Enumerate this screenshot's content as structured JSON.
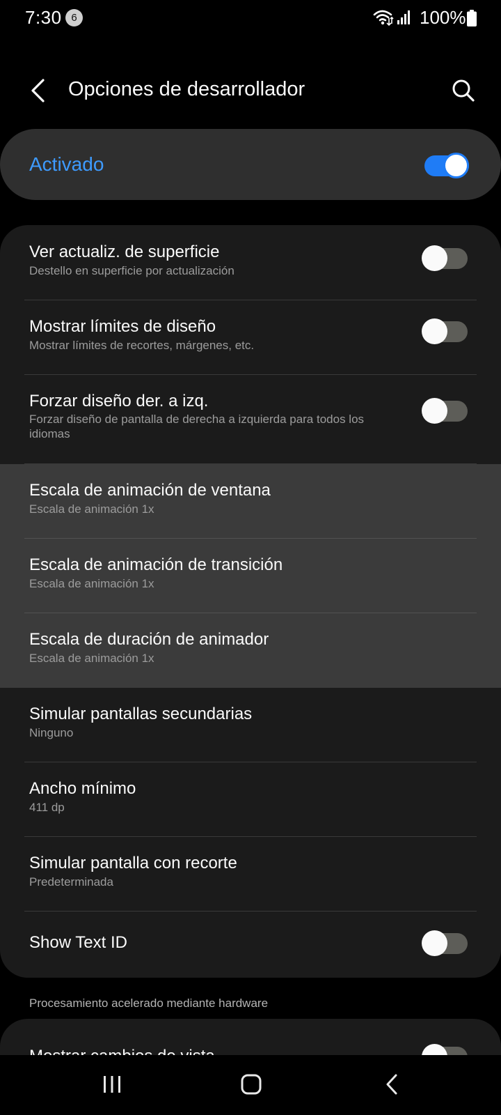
{
  "status_bar": {
    "time": "7:30",
    "notification_count": "6",
    "battery_percent": "100%",
    "icons": [
      "wifi-icon",
      "signal-icon",
      "battery-icon"
    ]
  },
  "header": {
    "title": "Opciones de desarrollador",
    "back_icon": "back-chevron-icon",
    "search_icon": "search-icon"
  },
  "master_switch": {
    "label": "Activado",
    "on": true
  },
  "rows": [
    {
      "title": "Ver actualiz. de superficie",
      "subtitle": "Destello en superficie por actualización",
      "toggle": false
    },
    {
      "title": "Mostrar límites de diseño",
      "subtitle": "Mostrar límites de recortes, márgenes, etc.",
      "toggle": false
    },
    {
      "title": "Forzar diseño der. a izq.",
      "subtitle": "Forzar diseño de pantalla de derecha a izquierda para todos los idiomas",
      "toggle": false
    },
    {
      "title": "Escala de animación de ventana",
      "subtitle": "Escala de animación 1x"
    },
    {
      "title": "Escala de animación de transición",
      "subtitle": "Escala de animación 1x"
    },
    {
      "title": "Escala de duración de animador",
      "subtitle": "Escala de animación 1x"
    },
    {
      "title": "Simular pantallas secundarias",
      "subtitle": "Ninguno"
    },
    {
      "title": "Ancho mínimo",
      "subtitle": "411 dp"
    },
    {
      "title": "Simular pantalla con recorte",
      "subtitle": "Predeterminada"
    },
    {
      "title": "Show Text ID",
      "toggle": false
    }
  ],
  "section": {
    "label": "Procesamiento acelerado mediante hardware"
  },
  "bottom_row": {
    "title": "Mostrar cambios de vista",
    "toggle": false
  },
  "colors": {
    "accent": "#3e9bff",
    "toggle_on": "#1f7cf6",
    "card_bg": "#1b1b1b",
    "highlight_bg": "#3b3b3b",
    "master_bg": "#2f2f2f"
  },
  "navbar": {
    "icons": [
      "recent-apps-icon",
      "home-icon",
      "back-icon"
    ]
  }
}
